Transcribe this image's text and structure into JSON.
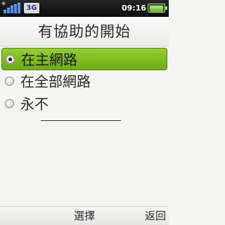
{
  "status_bar": {
    "bluetooth_icon": "bluetooth-icon",
    "signal_icon": "signal-strength-icon",
    "network_type": "3G",
    "time": "09:16",
    "battery_icon": "battery-icon",
    "battery_level": 0.9
  },
  "title": "有協助的開始",
  "options": [
    {
      "label": "在主網路",
      "selected": true
    },
    {
      "label": "在全部網路",
      "selected": false
    },
    {
      "label": "永不",
      "selected": false
    }
  ],
  "softkeys": {
    "center": "選擇",
    "right": "返回"
  },
  "colors": {
    "selection_green": "#7dbb1f",
    "status_bar_bg": "#141414",
    "background": "#f4f4f2"
  }
}
